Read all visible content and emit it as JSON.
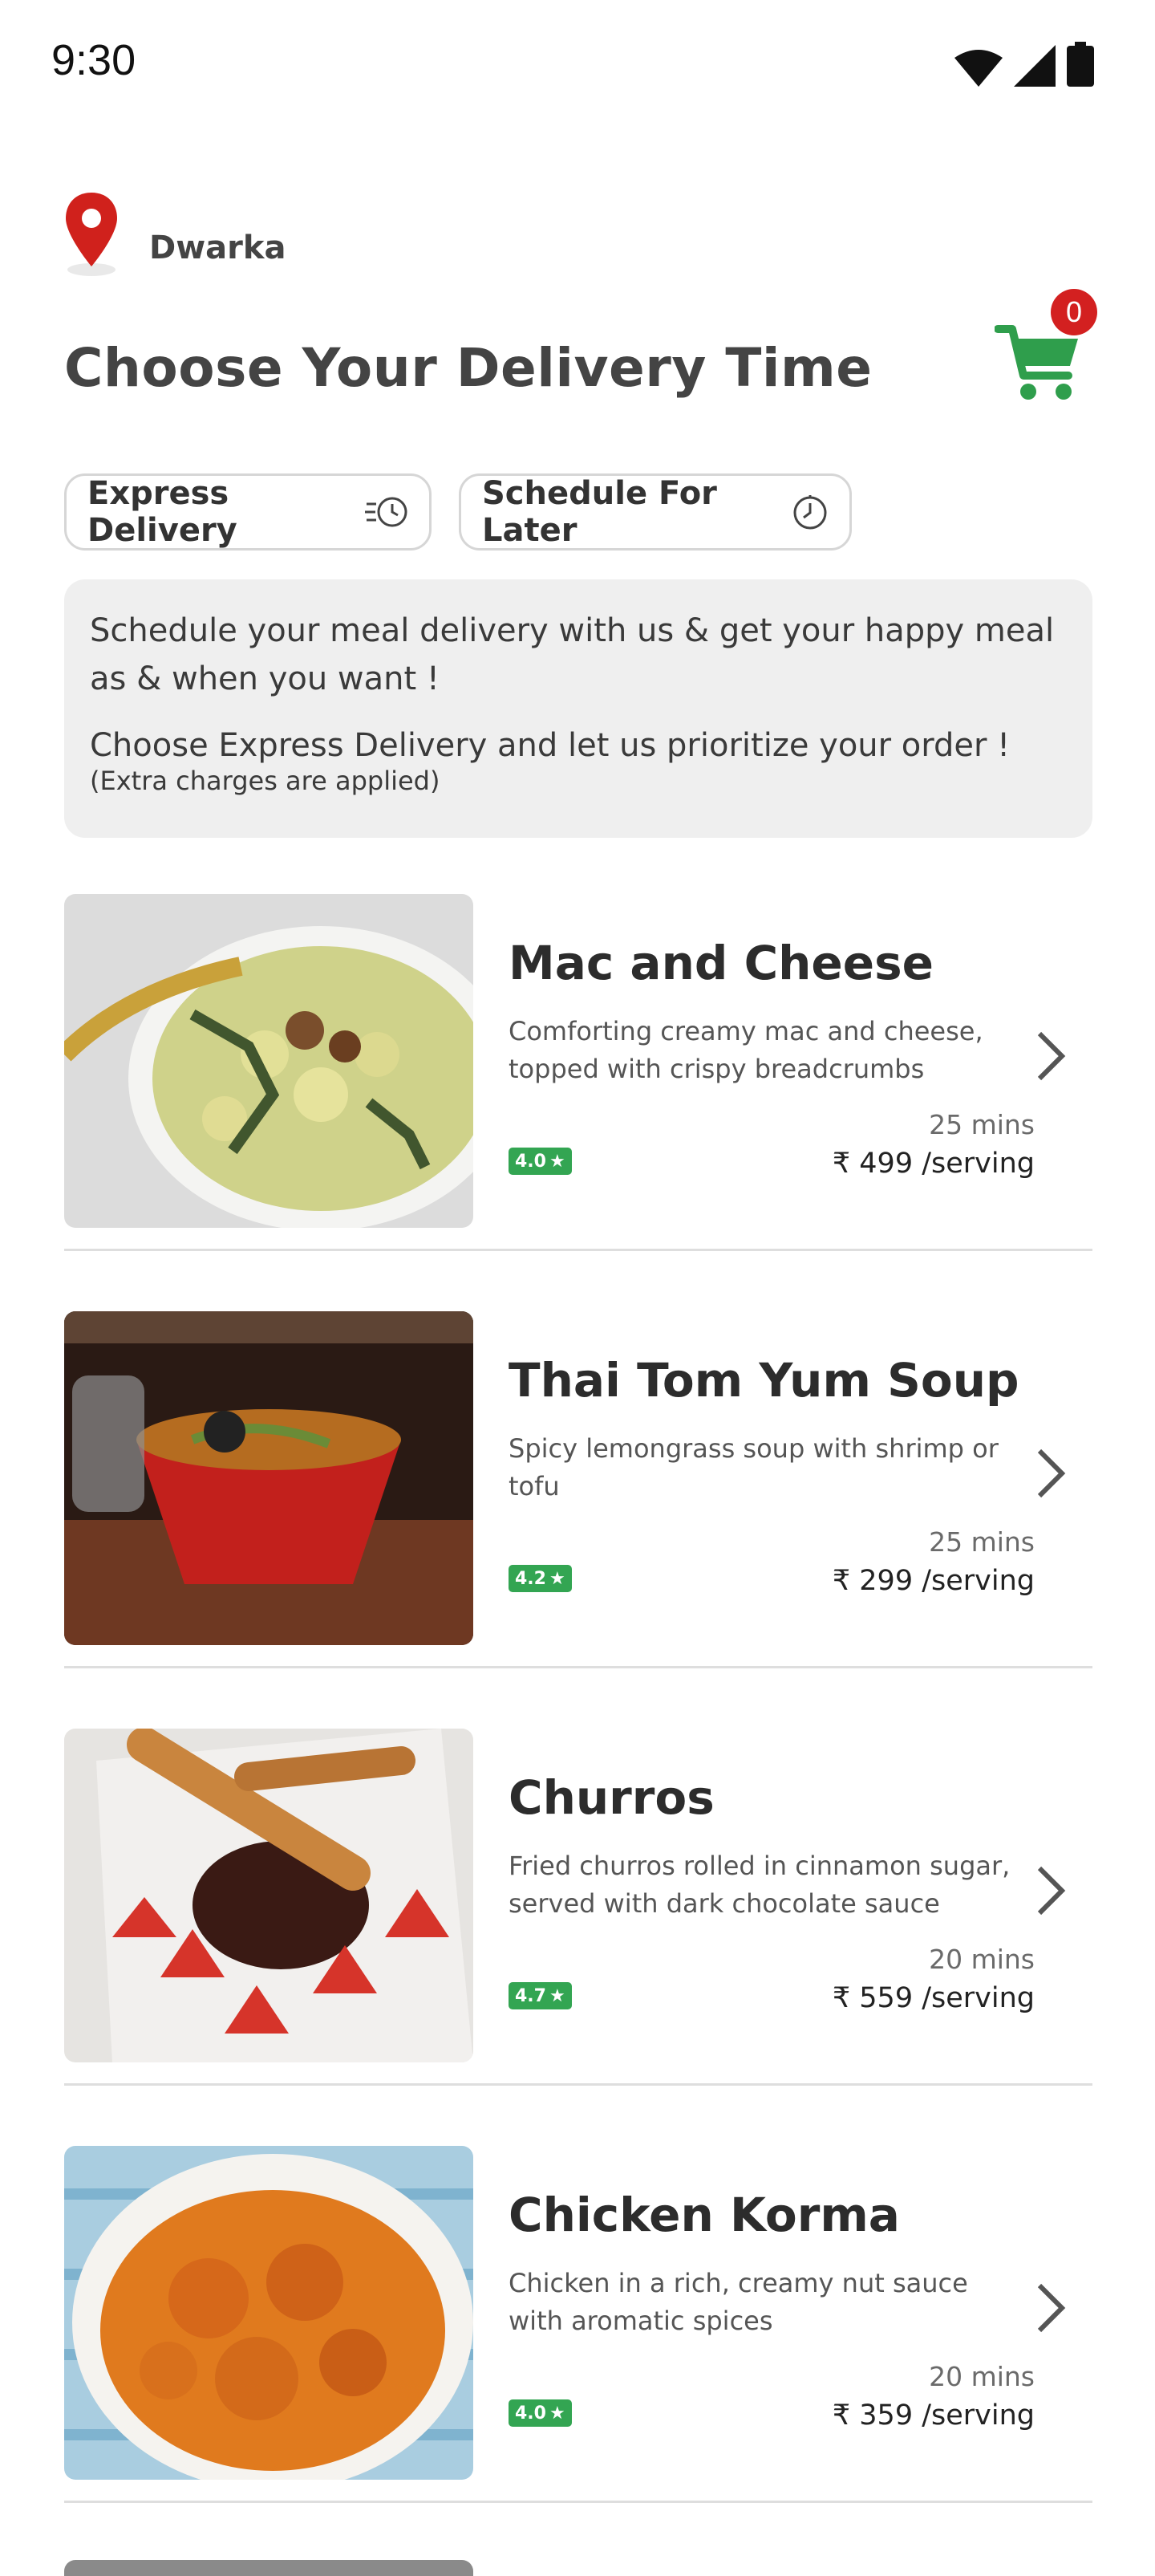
{
  "status_bar": {
    "time": "9:30"
  },
  "location": {
    "label": "Dwarka"
  },
  "header": {
    "title": "Choose Your Delivery Time"
  },
  "cart": {
    "count": "0"
  },
  "delivery_options": [
    {
      "label": "Express Delivery",
      "icon": "fast-clock-icon"
    },
    {
      "label": "Schedule For Later",
      "icon": "timer-icon"
    }
  ],
  "info": {
    "line1": "Schedule your meal delivery with us & get your happy meal as & when you want !",
    "line2": "Choose Express Delivery and let us prioritize your order !",
    "note": "(Extra charges are applied)"
  },
  "dishes": [
    {
      "name": "Mac and Cheese",
      "description": "Comforting creamy mac and cheese, topped with crispy breadcrumbs",
      "time": "25 mins",
      "price": "₹ 499 /serving",
      "rating": "4.0"
    },
    {
      "name": "Thai Tom Yum Soup",
      "description": "Spicy lemongrass soup with shrimp or tofu",
      "time": "25 mins",
      "price": "₹ 299 /serving",
      "rating": "4.2"
    },
    {
      "name": "Churros",
      "description": "Fried churros rolled in cinnamon sugar, served with dark chocolate  sauce",
      "time": "20 mins",
      "price": "₹ 559 /serving",
      "rating": "4.7"
    },
    {
      "name": "Chicken Korma",
      "description": "Chicken in a rich, creamy nut sauce with aromatic spices",
      "time": "20 mins",
      "price": "₹ 359 /serving",
      "rating": "4.0"
    }
  ],
  "colors": {
    "accent_green": "#33a552",
    "cart_green": "#2f9e4c",
    "badge_red": "#d32020",
    "pin_red": "#d0211c"
  }
}
